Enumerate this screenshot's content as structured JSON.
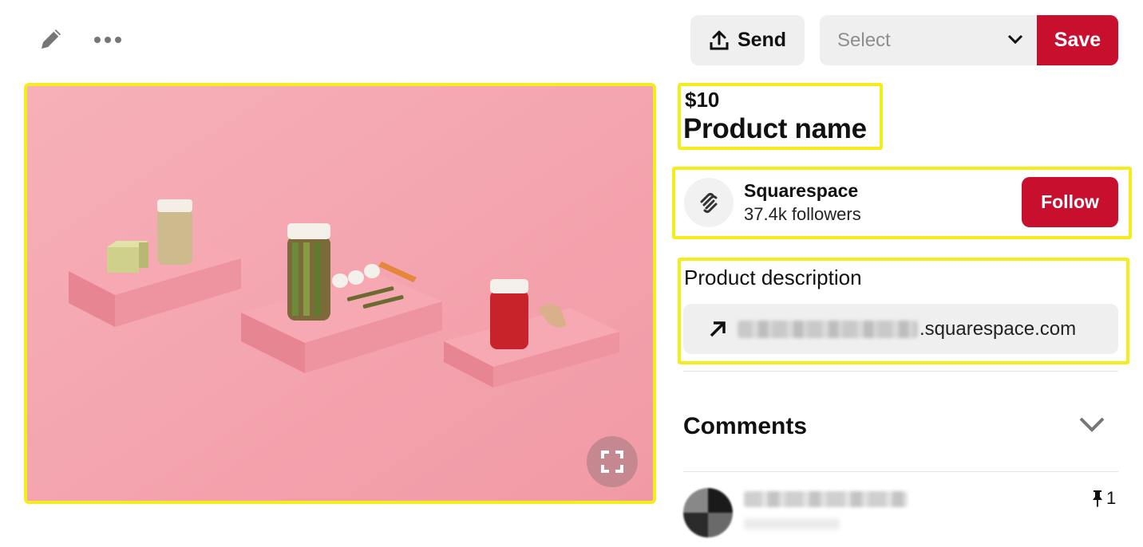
{
  "toolbar": {
    "edit_icon": "pencil-icon",
    "more_icon": "ellipsis-icon"
  },
  "actions": {
    "send_label": "Send",
    "select_placeholder": "Select",
    "save_label": "Save"
  },
  "product": {
    "price": "$10",
    "name": "Product name",
    "description": "Product description",
    "link_domain": ".squarespace.com"
  },
  "creator": {
    "name": "Squarespace",
    "followers": "37.4k followers",
    "follow_label": "Follow"
  },
  "comments": {
    "title": "Comments",
    "pin_count": "1"
  },
  "colors": {
    "accent": "#c8102e",
    "highlight": "#f5ec1c",
    "image_background": "#f4a7b0"
  }
}
